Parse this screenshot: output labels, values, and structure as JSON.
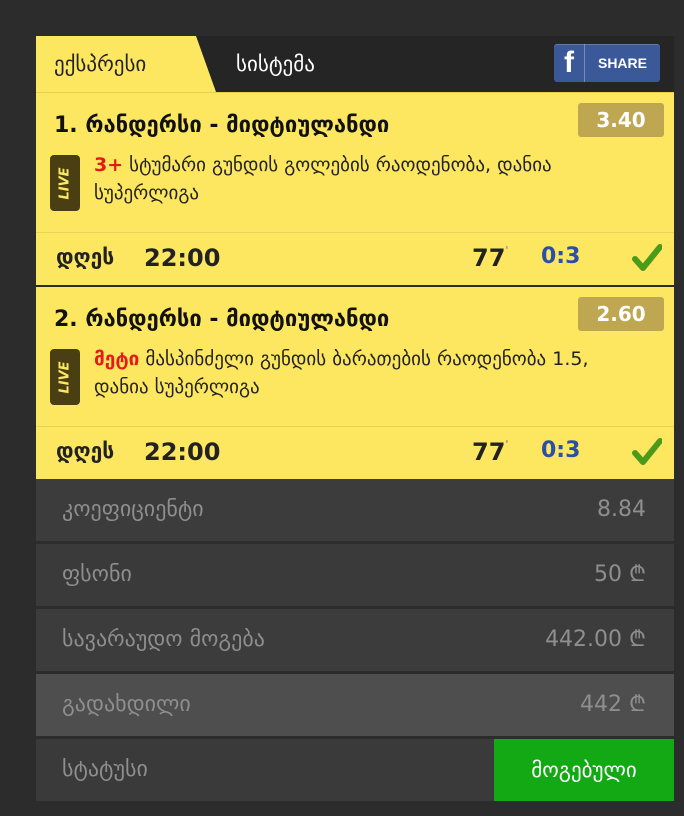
{
  "tabs": {
    "express": "ექსპრესი",
    "system": "სისტემა"
  },
  "share": {
    "icon": "f",
    "label": "SHARE"
  },
  "bets": [
    {
      "number": "1.",
      "match": "რანდერსი - მიდტიულანდი",
      "odds": "3.40",
      "live": "LIVE",
      "highlight": "3+",
      "description": " სტუმარი გუნდის გოლების რაოდენობა, დანია სუპერლიგა",
      "day": "დღეს",
      "time": "22:00",
      "minute": "77",
      "minute_mark": "'",
      "score": "0:3"
    },
    {
      "number": "2.",
      "match": "რანდერსი - მიდტიულანდი",
      "odds": "2.60",
      "live": "LIVE",
      "highlight": "მეტი",
      "description": " მასპინძელი გუნდის ბარათების რაოდენობა 1.5, დანია სუპერლიგა",
      "day": "დღეს",
      "time": "22:00",
      "minute": "77",
      "minute_mark": "'",
      "score": "0:3"
    }
  ],
  "summary": {
    "coefficient_label": "კოეფიციენტი",
    "coefficient_value": "8.84",
    "stake_label": "ფსონი",
    "stake_value": "50 ₾",
    "potential_label": "სავარაუდო მოგება",
    "potential_value": "442.00 ₾",
    "paid_label": "გადახდილი",
    "paid_value": "442 ₾",
    "status_label": "სტატუსი",
    "status_value": "მოგებული"
  },
  "colors": {
    "yellow": "#fde760",
    "win_green": "#12a915",
    "odds_badge": "#bfa752",
    "score_blue": "#2a4fa8",
    "facebook": "#3b5998"
  }
}
